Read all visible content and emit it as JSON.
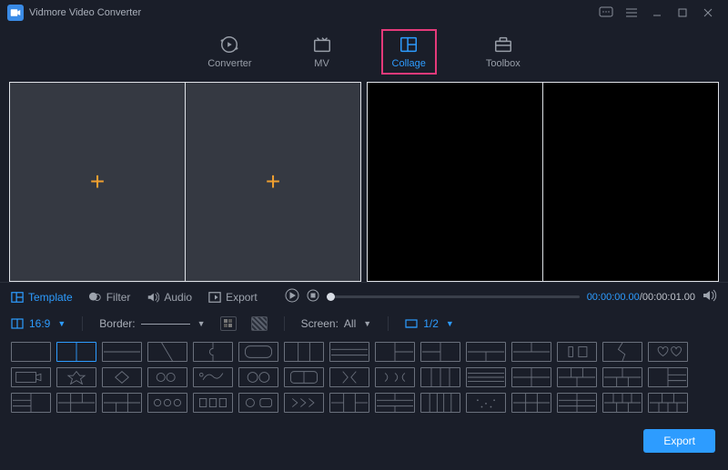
{
  "app": {
    "title": "Vidmore Video Converter"
  },
  "nav": {
    "converter": "Converter",
    "mv": "MV",
    "collage": "Collage",
    "toolbox": "Toolbox"
  },
  "subtabs": {
    "template": "Template",
    "filter": "Filter",
    "audio": "Audio",
    "export": "Export"
  },
  "opts": {
    "ratio": "16:9",
    "border_label": "Border:",
    "screen_label": "Screen:",
    "screen_value": "All",
    "split": "1/2"
  },
  "playback": {
    "current": "00:00:00.00",
    "total": "00:00:01.00"
  },
  "footer": {
    "export": "Export"
  }
}
